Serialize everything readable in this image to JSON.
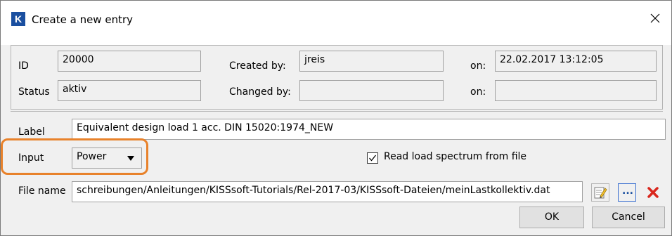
{
  "window": {
    "title": "Create a new entry",
    "app_icon_letter": "K"
  },
  "info": {
    "id_label": "ID",
    "id_value": "20000",
    "created_by_label": "Created by:",
    "created_by_value": "jreis",
    "on_label_1": "on:",
    "created_on_value": "22.02.2017 13:12:05",
    "status_label": "Status",
    "status_value": "aktiv",
    "changed_by_label": "Changed by:",
    "changed_by_value": "",
    "on_label_2": "on:",
    "changed_on_value": ""
  },
  "form": {
    "label_label": "Label",
    "label_value": "Equivalent design load 1 acc. DIN 15020:1974_NEW",
    "input_label": "Input",
    "input_selected": "Power",
    "read_from_file_label": "Read load spectrum from file",
    "read_from_file_checked": true,
    "file_name_label": "File name",
    "file_name_value": "schreibungen/Anleitungen/KISSsoft-Tutorials/Rel-2017-03/KISSsoft-Dateien/meinLastkollektiv.dat",
    "browse_label": "..."
  },
  "buttons": {
    "ok": "OK",
    "cancel": "Cancel"
  },
  "colors": {
    "highlight": "#e8822b",
    "app_icon": "#1a4fa0",
    "delete_icon": "#d9261c"
  }
}
